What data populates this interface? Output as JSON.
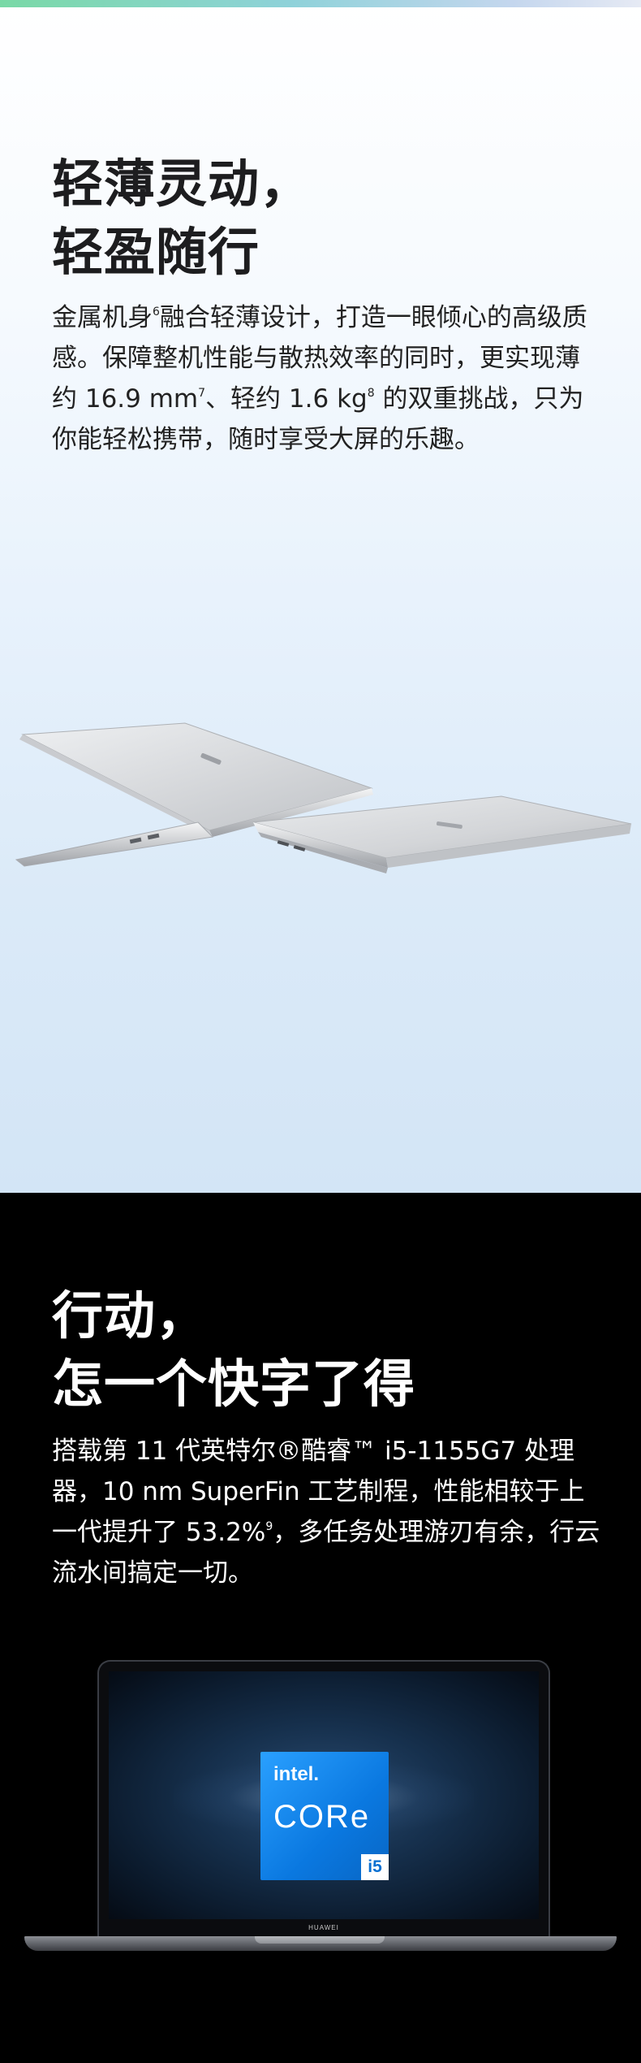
{
  "section1": {
    "title_line1": "轻薄灵动，",
    "title_line2": "轻盈随行",
    "para_a": "金属机身",
    "sup_6": "6",
    "para_b": "融合轻薄设计，打造一眼倾心的高级质感。保障整机性能与散热效率的同时，更实现薄约 16.9 mm",
    "sup_7": "7",
    "para_c": "、轻约 1.6 kg",
    "sup_8": "8",
    "para_d": " 的双重挑战，只为你能轻松携带，随时享受大屏的乐趣。"
  },
  "section2": {
    "title_line1": "行动，",
    "title_line2": "怎一个快字了得",
    "para_a": "搭载第 11 代英特尔®酷睿™ i5-1155G7 处理器，10 nm SuperFin 工艺制程，性能相较于上一代提升了 53.2%",
    "sup_9": "9",
    "para_b": "，多任务处理游刃有余，行云流水间搞定一切。",
    "badge_brand": "intel.",
    "badge_product": "CORe",
    "badge_tier": "i5",
    "laptop_logo": "HUAWEI"
  },
  "colors": {
    "top_accent": "#79d9a6",
    "intel_blue": "#0a78e0",
    "laptop_silver": "#d9dadc"
  }
}
